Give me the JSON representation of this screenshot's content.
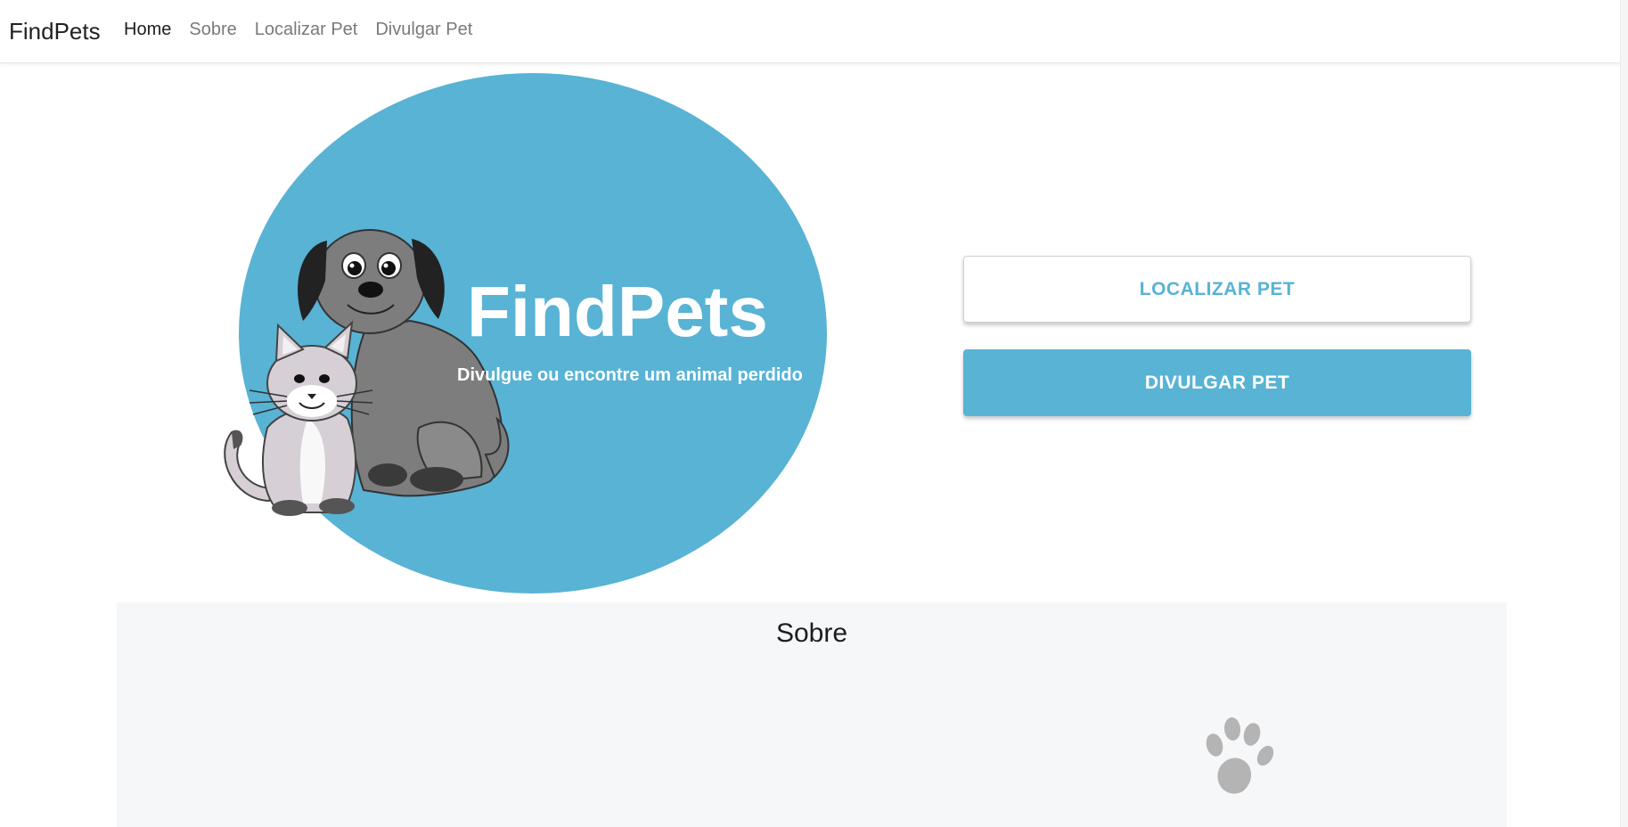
{
  "navbar": {
    "brand": "FindPets",
    "links": [
      {
        "label": "Home",
        "active": true
      },
      {
        "label": "Sobre",
        "active": false
      },
      {
        "label": "Localizar Pet",
        "active": false
      },
      {
        "label": "Divulgar Pet",
        "active": false
      }
    ]
  },
  "hero": {
    "title": "FindPets",
    "subtitle": "Divulgue ou encontre um animal perdido",
    "circle_color": "#58b3d5",
    "illustration": [
      "dog-illustration",
      "cat-illustration"
    ]
  },
  "actions": {
    "localizar_label": "LOCALIZAR PET",
    "divulgar_label": "DIVULGAR PET",
    "accent_color": "#58b3d5"
  },
  "sobre": {
    "title": "Sobre",
    "icon": "paw-icon"
  }
}
